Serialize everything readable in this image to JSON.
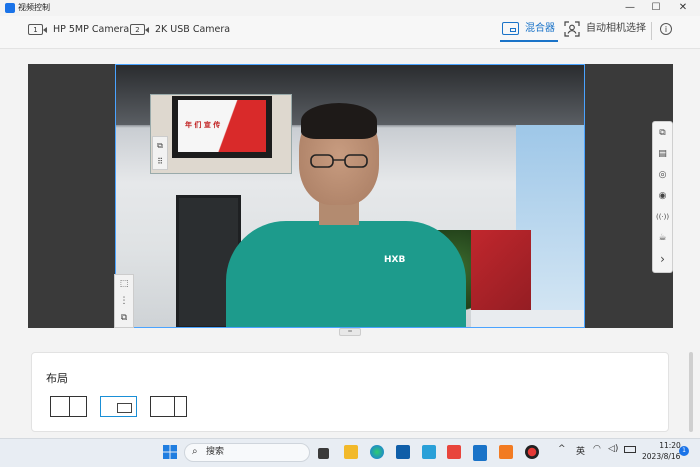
{
  "window": {
    "title": "视频控制",
    "minimize_glyph": "—",
    "maximize_glyph": "☐",
    "close_glyph": "✕"
  },
  "cameras": [
    {
      "badge": "1",
      "label": "HP 5MP Camera"
    },
    {
      "badge": "2",
      "label": "2K USB Camera"
    }
  ],
  "toolbar": {
    "mixer_label": "混合器",
    "auto_camera_label": "自动相机选择",
    "info_glyph": "i"
  },
  "preview": {
    "shirt_logo": "HXB",
    "pip_screen_text": "年 们 宣 传",
    "pip_tool_glyphs": [
      "⧉",
      "⠿"
    ],
    "left_tool_glyphs": [
      "⬚",
      "⋮",
      "⧉"
    ],
    "right_tool_glyphs": [
      "⧉",
      "▤",
      "◎",
      "◉",
      "((·))",
      "☕",
      "›"
    ],
    "drag_handle_glyph": "═"
  },
  "layout": {
    "title": "布局",
    "options": [
      "split-two",
      "picture-in-picture",
      "split-two-alt"
    ],
    "selected": 1
  },
  "taskbar": {
    "search_glyph": "⌕",
    "search_label": "搜索",
    "apps": [
      "file-explorer",
      "folder",
      "edge",
      "store",
      "ai-tool",
      "wps",
      "video-control",
      "media-app",
      "record"
    ],
    "tray_chevron": "^",
    "ime": "英",
    "wifi_glyph": "◠",
    "volume_glyph": "◁)",
    "time": "11:20",
    "date": "2023/8/16",
    "notification_count": "1"
  },
  "colors": {
    "accent": "#1a73c8",
    "selection_border": "#4aa3ff",
    "shirt": "#1d9b8c"
  }
}
